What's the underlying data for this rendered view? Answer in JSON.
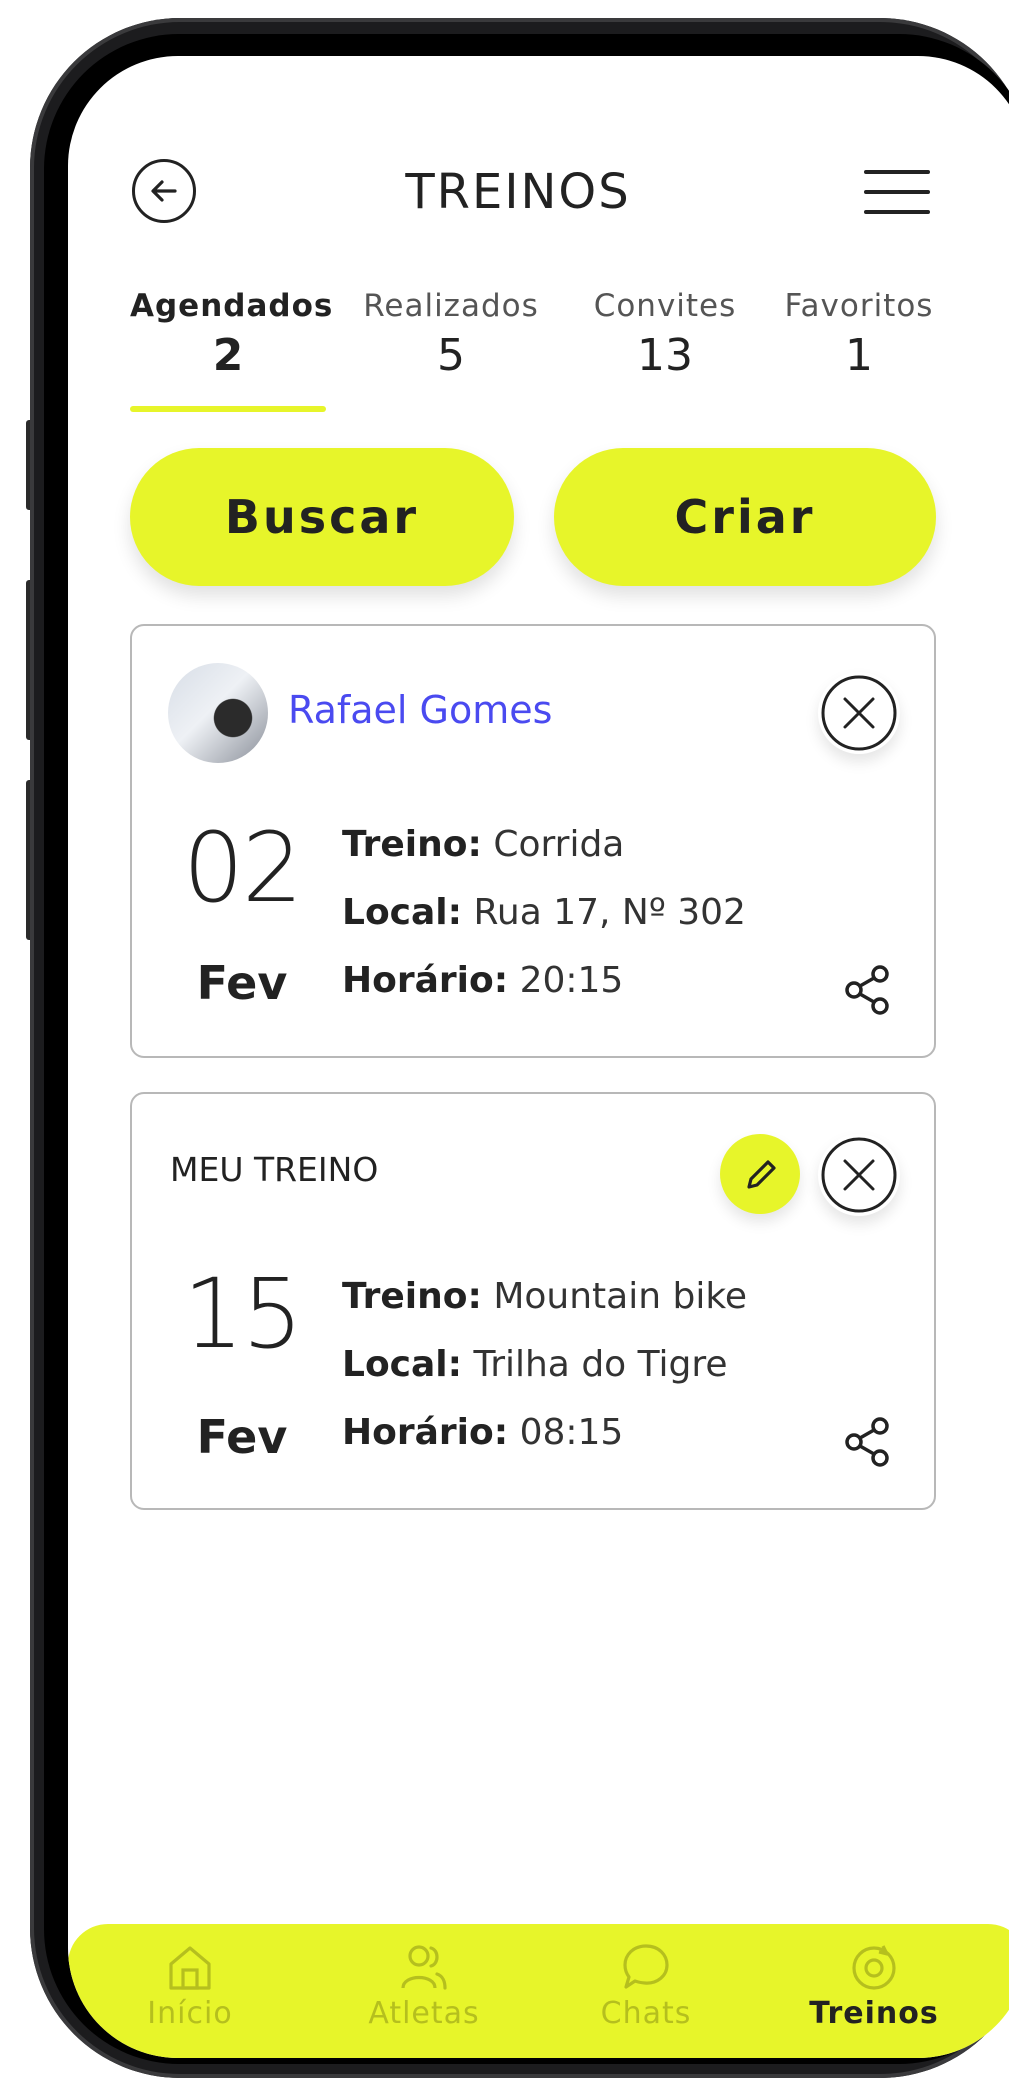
{
  "header": {
    "title": "TREINOS"
  },
  "tabs": [
    {
      "label": "Agendados",
      "count": "2"
    },
    {
      "label": "Realizados",
      "count": "5"
    },
    {
      "label": "Convites",
      "count": "13"
    },
    {
      "label": "Favoritos",
      "count": "1"
    }
  ],
  "actions": {
    "search_label": "Buscar",
    "create_label": "Criar"
  },
  "cards": [
    {
      "user_name": "Rafael Gomes",
      "day": "02",
      "month": "Fev",
      "treino_label": "Treino:",
      "treino_value": " Corrida",
      "local_label": "Local:",
      "local_value": " Rua 17, Nº 302",
      "horario_label": "Horário:",
      "horario_value": " 20:15"
    },
    {
      "heading": "MEU TREINO",
      "day": "15",
      "month": "Fev",
      "treino_label": "Treino:",
      "treino_value": " Mountain bike",
      "local_label": "Local:",
      "local_value": " Trilha do Tigre",
      "horario_label": "Horário:",
      "horario_value": " 08:15"
    }
  ],
  "bottom_nav": [
    {
      "label": "Início",
      "icon": "home-icon"
    },
    {
      "label": "Atletas",
      "icon": "users-icon"
    },
    {
      "label": "Chats",
      "icon": "chat-icon"
    },
    {
      "label": "Treinos",
      "icon": "workout-icon"
    }
  ],
  "colors": {
    "accent": "#e7f52a",
    "link": "#4a4af0",
    "text": "#222222"
  }
}
